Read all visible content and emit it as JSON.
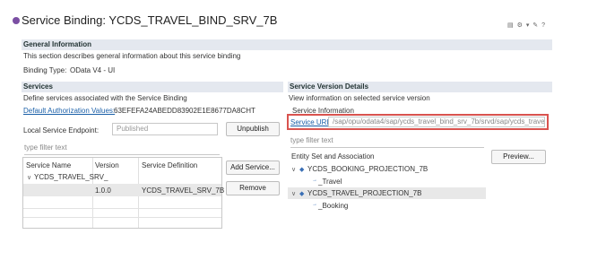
{
  "header": {
    "title": "Service Binding: YCDS_TRAVEL_BIND_SRV_7B"
  },
  "general": {
    "heading": "General Information",
    "description": "This section describes general information about this service binding",
    "binding_type_label": "Binding Type:",
    "binding_type_value": "OData V4 - UI"
  },
  "services": {
    "heading": "Services",
    "description": "Define services associated with the Service Binding",
    "auth_link": "Default Authorization Values:",
    "auth_value": "63EFEFA24ABEDD83902E1E8677DA8CHT",
    "endpoint_label": "Local Service Endpoint:",
    "endpoint_value": "Published",
    "unpublish_label": "Unpublish",
    "filter_placeholder": "type filter text",
    "columns": [
      "Service Name",
      "Version",
      "Service Definition"
    ],
    "service_name": "YCDS_TRAVEL_SRV_",
    "version": "1.0.0",
    "definition": "YCDS_TRAVEL_SRV_7B",
    "add_label": "Add Service...",
    "remove_label": "Remove"
  },
  "details": {
    "heading": "Service Version Details",
    "description": "View information on selected service version",
    "info_label": "Service Information",
    "url_link": "Service URL:",
    "url_value": "/sap/opu/odata4/sap/ycds_travel_bind_srv_7b/srvd/sap/ycds_travel_srv",
    "filter_placeholder": "type filter text",
    "entity_header": "Entity Set and Association",
    "entities": [
      {
        "name": "YCDS_BOOKING_PROJECTION_7B",
        "association": "_Travel"
      },
      {
        "name": "YCDS_TRAVEL_PROJECTION_7B",
        "association": "_Booking"
      }
    ],
    "preview_label": "Preview..."
  }
}
